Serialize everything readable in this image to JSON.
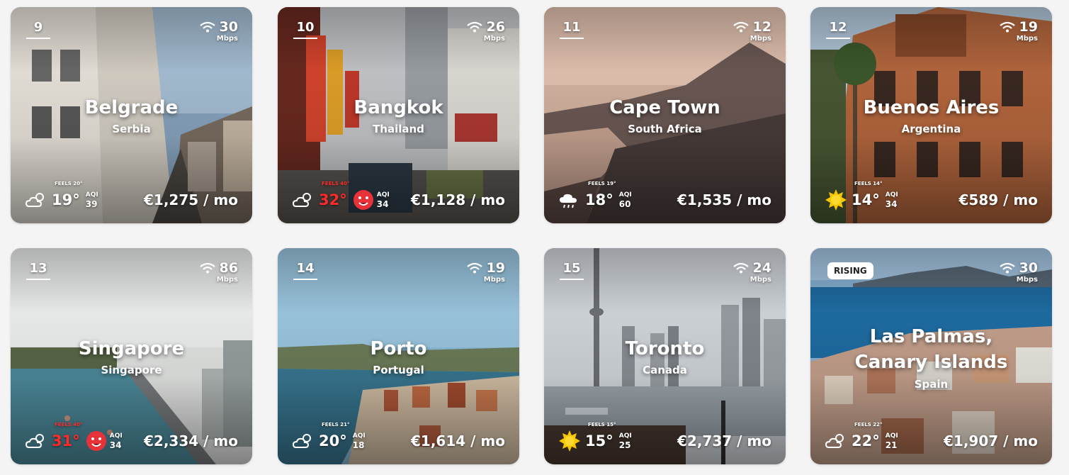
{
  "cards": [
    {
      "rank": "9",
      "badge": "",
      "city": "Belgrade",
      "country": "Serbia",
      "wifi": "30",
      "wifi_unit": "Mbps",
      "weather_icon": "cloud-sun-icon",
      "feels": "FEELS 20°",
      "temp": "19°",
      "temp_hot": false,
      "aqi_label": "AQI",
      "aqi": "39",
      "aqi_face": false,
      "price": "€1,275 / mo"
    },
    {
      "rank": "10",
      "badge": "",
      "city": "Bangkok",
      "country": "Thailand",
      "wifi": "26",
      "wifi_unit": "Mbps",
      "weather_icon": "cloud-sun-icon",
      "feels": "FEELS 40°",
      "temp": "32°",
      "temp_hot": true,
      "aqi_label": "AQI",
      "aqi": "34",
      "aqi_face": true,
      "price": "€1,128 / mo"
    },
    {
      "rank": "11",
      "badge": "",
      "city": "Cape Town",
      "country": "South Africa",
      "wifi": "12",
      "wifi_unit": "Mbps",
      "weather_icon": "cloud-rain-icon",
      "feels": "FEELS 19°",
      "temp": "18°",
      "temp_hot": false,
      "aqi_label": "AQI",
      "aqi": "60",
      "aqi_face": false,
      "price": "€1,535 / mo"
    },
    {
      "rank": "12",
      "badge": "",
      "city": "Buenos Aires",
      "country": "Argentina",
      "wifi": "19",
      "wifi_unit": "Mbps",
      "weather_icon": "sun-icon",
      "feels": "FEELS 14°",
      "temp": "14°",
      "temp_hot": false,
      "aqi_label": "AQI",
      "aqi": "34",
      "aqi_face": false,
      "price": "€589 / mo"
    },
    {
      "rank": "13",
      "badge": "",
      "city": "Singapore",
      "country": "Singapore",
      "wifi": "86",
      "wifi_unit": "Mbps",
      "weather_icon": "cloud-sun-icon",
      "feels": "FEELS 40°",
      "temp": "31°",
      "temp_hot": true,
      "aqi_label": "AQI",
      "aqi": "34",
      "aqi_face": true,
      "price": "€2,334 / mo"
    },
    {
      "rank": "14",
      "badge": "",
      "city": "Porto",
      "country": "Portugal",
      "wifi": "19",
      "wifi_unit": "Mbps",
      "weather_icon": "cloud-sun-icon",
      "feels": "FEELS 21°",
      "temp": "20°",
      "temp_hot": false,
      "aqi_label": "AQI",
      "aqi": "18",
      "aqi_face": false,
      "price": "€1,614 / mo"
    },
    {
      "rank": "15",
      "badge": "",
      "city": "Toronto",
      "country": "Canada",
      "wifi": "24",
      "wifi_unit": "Mbps",
      "weather_icon": "sun-icon",
      "feels": "FEELS 15°",
      "temp": "15°",
      "temp_hot": false,
      "aqi_label": "AQI",
      "aqi": "25",
      "aqi_face": false,
      "price": "€2,737 / mo"
    },
    {
      "rank": "",
      "badge": "RISING",
      "city": "Las Palmas, Canary Islands",
      "city_line1": "Las Palmas,",
      "city_line2": "Canary Islands",
      "country": "Spain",
      "wifi": "30",
      "wifi_unit": "Mbps",
      "weather_icon": "cloud-sun-icon",
      "feels": "FEELS 22°",
      "temp": "22°",
      "temp_hot": false,
      "aqi_label": "AQI",
      "aqi": "21",
      "aqi_face": false,
      "price": "€1,907 / mo"
    }
  ],
  "colors": {
    "hot_temp": "#ff2a2a",
    "aqi_face": "#e8323a",
    "sun": "#f7c600"
  }
}
